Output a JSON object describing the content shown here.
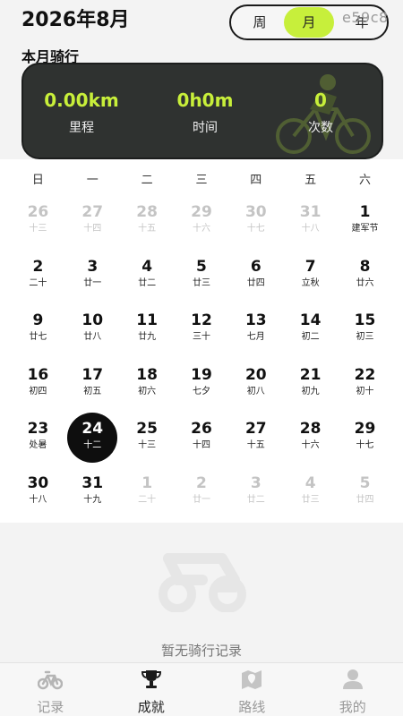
{
  "header": {
    "month_title": "2026年8月",
    "segments": {
      "week": "周",
      "month": "月",
      "year": "年",
      "selected": "月"
    },
    "watermark": "e59c8",
    "accent_color": "#c7ef3b"
  },
  "section_label": "本月骑行",
  "stats": [
    {
      "value": "0.00km",
      "label": "里程"
    },
    {
      "value": "0h0m",
      "label": "时间"
    },
    {
      "value": "0",
      "label": "次数"
    }
  ],
  "calendar": {
    "weekdays": [
      "日",
      "一",
      "二",
      "三",
      "四",
      "五",
      "六"
    ],
    "selected_day": "24",
    "days": [
      {
        "num": "26",
        "lunar": "十三",
        "dim": true
      },
      {
        "num": "27",
        "lunar": "十四",
        "dim": true
      },
      {
        "num": "28",
        "lunar": "十五",
        "dim": true
      },
      {
        "num": "29",
        "lunar": "十六",
        "dim": true
      },
      {
        "num": "30",
        "lunar": "十七",
        "dim": true
      },
      {
        "num": "31",
        "lunar": "十八",
        "dim": true
      },
      {
        "num": "1",
        "lunar": "建军节"
      },
      {
        "num": "2",
        "lunar": "二十"
      },
      {
        "num": "3",
        "lunar": "廿一"
      },
      {
        "num": "4",
        "lunar": "廿二"
      },
      {
        "num": "5",
        "lunar": "廿三"
      },
      {
        "num": "6",
        "lunar": "廿四"
      },
      {
        "num": "7",
        "lunar": "立秋"
      },
      {
        "num": "8",
        "lunar": "廿六"
      },
      {
        "num": "9",
        "lunar": "廿七"
      },
      {
        "num": "10",
        "lunar": "廿八"
      },
      {
        "num": "11",
        "lunar": "廿九"
      },
      {
        "num": "12",
        "lunar": "三十"
      },
      {
        "num": "13",
        "lunar": "七月"
      },
      {
        "num": "14",
        "lunar": "初二"
      },
      {
        "num": "15",
        "lunar": "初三"
      },
      {
        "num": "16",
        "lunar": "初四"
      },
      {
        "num": "17",
        "lunar": "初五"
      },
      {
        "num": "18",
        "lunar": "初六"
      },
      {
        "num": "19",
        "lunar": "七夕"
      },
      {
        "num": "20",
        "lunar": "初八"
      },
      {
        "num": "21",
        "lunar": "初九"
      },
      {
        "num": "22",
        "lunar": "初十"
      },
      {
        "num": "23",
        "lunar": "处暑"
      },
      {
        "num": "24",
        "lunar": "十二",
        "selected": true
      },
      {
        "num": "25",
        "lunar": "十三"
      },
      {
        "num": "26",
        "lunar": "十四"
      },
      {
        "num": "27",
        "lunar": "十五"
      },
      {
        "num": "28",
        "lunar": "十六"
      },
      {
        "num": "29",
        "lunar": "十七"
      },
      {
        "num": "30",
        "lunar": "十八"
      },
      {
        "num": "31",
        "lunar": "十九"
      },
      {
        "num": "1",
        "lunar": "二十",
        "dim": true
      },
      {
        "num": "2",
        "lunar": "廿一",
        "dim": true
      },
      {
        "num": "3",
        "lunar": "廿二",
        "dim": true
      },
      {
        "num": "4",
        "lunar": "廿三",
        "dim": true
      },
      {
        "num": "5",
        "lunar": "廿四",
        "dim": true
      }
    ]
  },
  "empty_state": {
    "icon": "bicycle-icon",
    "text": "暂无骑行记录"
  },
  "tabbar": {
    "active": "成就",
    "tabs": [
      {
        "label": "记录",
        "icon": "bicycle-icon"
      },
      {
        "label": "成就",
        "icon": "trophy-icon"
      },
      {
        "label": "路线",
        "icon": "map-icon"
      },
      {
        "label": "我的",
        "icon": "person-icon"
      }
    ]
  }
}
